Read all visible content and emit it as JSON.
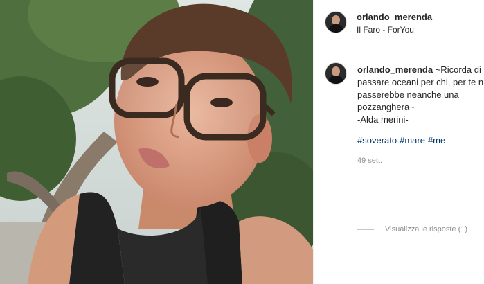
{
  "post": {
    "username": "orlando_merenda",
    "location": "Il Faro - ForYou"
  },
  "comment": {
    "username": "orlando_merenda",
    "lines": [
      "~Ricorda di",
      "passare oceani per chi, per te n",
      "passerebbe neanche una",
      "pozzanghera~",
      "-Alda merini-"
    ],
    "hashtags": [
      "#soverato",
      "#mare",
      "#me"
    ],
    "time": "49 sett.",
    "view_replies": "Visualizza le risposte (1)"
  }
}
